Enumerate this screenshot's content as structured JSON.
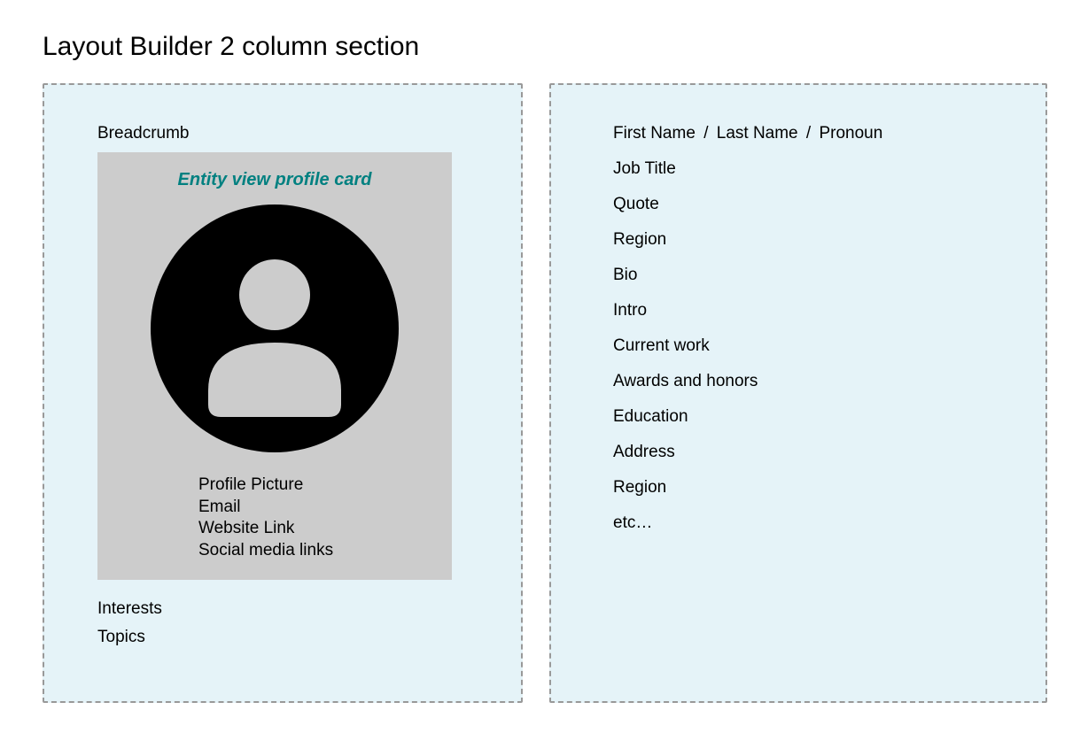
{
  "title": "Layout Builder 2 column section",
  "left": {
    "breadcrumb_label": "Breadcrumb",
    "card": {
      "title": "Entity view profile card",
      "fields": [
        "Profile Picture",
        "Email",
        "Website Link",
        "Social media links"
      ]
    },
    "below": [
      "Interests",
      "Topics"
    ]
  },
  "right": {
    "name_row": {
      "first_name": "First Name",
      "sep1": "/",
      "last_name": "Last Name",
      "sep2": "/",
      "pronoun": "Pronoun"
    },
    "fields": [
      "Job Title",
      "Quote",
      "Region",
      "Bio",
      "Intro",
      "Current work",
      "Awards and honors",
      "Education",
      "Address",
      "Region",
      "etc…"
    ]
  }
}
